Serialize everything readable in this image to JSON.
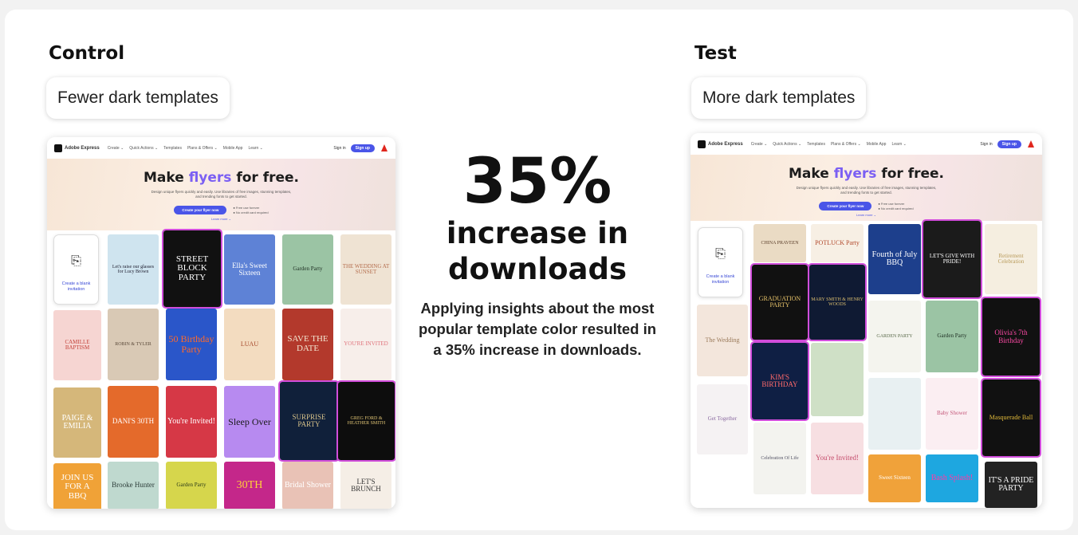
{
  "control": {
    "heading": "Control",
    "label": "Fewer dark templates"
  },
  "test": {
    "heading": "Test",
    "label": "More dark templates"
  },
  "result": {
    "percent": "35%",
    "headline_line1": "increase in",
    "headline_line2": "downloads",
    "description": "Applying insights about the most popular template color resulted in a 35% increase in downloads."
  },
  "mock_page": {
    "brand": "Adobe Express",
    "nav_items": [
      "Create ⌄",
      "Quick Actions ⌄",
      "Templates",
      "Plans & Offers ⌄",
      "Mobile App",
      "Learn ⌄"
    ],
    "sign_in": "Sign in",
    "sign_up": "Sign up",
    "hero_title_prefix": "Make ",
    "hero_title_highlight": "flyers",
    "hero_title_suffix": " for free.",
    "hero_subtitle_line1": "Design unique flyers quickly and easily. Use libraries of free images, stunning templates,",
    "hero_subtitle_line2": "and trending fonts to get started.",
    "cta_label": "Create your flyer now",
    "bullet_1": "● Free use forever",
    "bullet_2": "● No credit card required",
    "learn_more": "Learn more ⌄",
    "blank_label": "Create a blank invitation",
    "blank_icon": "new-document-icon"
  },
  "control_tiles": [
    {
      "text": "Let's raise our glasses for Lucy Brown",
      "bg": "#cfe4ef",
      "fg": "#223"
    },
    {
      "text": "STREET BLOCK PARTY",
      "bg": "#111111",
      "fg": "#ffffff",
      "highlight": true
    },
    {
      "text": "Ella's Sweet Sixteen",
      "bg": "#5e82d6",
      "fg": "#ffffff"
    },
    {
      "text": "Garden Party",
      "bg": "#9bc4a4",
      "fg": "#1d2d22"
    },
    {
      "text": "THE WEDDING AT SUNSET",
      "bg": "#efe3d3",
      "fg": "#b46d4d"
    },
    {
      "text": "CAMILLE BAPTISM",
      "bg": "#f6d5d2",
      "fg": "#c4433b"
    },
    {
      "text": "ROBIN & TYLER",
      "bg": "#d9c9b5",
      "fg": "#5b4a3a"
    },
    {
      "text": "50 Birthday Party",
      "bg": "#2a56c9",
      "fg": "#ff6a2a"
    },
    {
      "text": "LUAU",
      "bg": "#f3dcc0",
      "fg": "#a5482a"
    },
    {
      "text": "SAVE THE DATE",
      "bg": "#b3392c",
      "fg": "#f3e6d2"
    },
    {
      "text": "YOU'RE INVITED",
      "bg": "#f7eeea",
      "fg": "#e0737c"
    },
    {
      "text": "PAIGE & EMILIA",
      "bg": "#d5b77a",
      "fg": "#ffffff"
    },
    {
      "text": "DANI'S 30TH",
      "bg": "#e46a2b",
      "fg": "#ffffff"
    },
    {
      "text": "You're Invited!",
      "bg": "#d63846",
      "fg": "#ffffff"
    },
    {
      "text": "Sleep Over",
      "bg": "#b78af0",
      "fg": "#1b1b1b"
    },
    {
      "text": "SURPRISE PARTY",
      "bg": "#10203a",
      "fg": "#d8c28a",
      "highlight": true
    },
    {
      "text": "GREG FORD & HEATHER SMITH",
      "bg": "#0d0d0d",
      "fg": "#e2c676",
      "highlight": true
    },
    {
      "text": "JOIN US FOR A BBQ",
      "bg": "#f0a237",
      "fg": "#ffffff"
    },
    {
      "text": "Brooke Hunter",
      "bg": "#bfd9cf",
      "fg": "#2d3d3a"
    },
    {
      "text": "Garden Party",
      "bg": "#d6d64c",
      "fg": "#2d3d1a"
    },
    {
      "text": "30TH",
      "bg": "#c4278a",
      "fg": "#ffd23a"
    },
    {
      "text": "Bridal Shower",
      "bg": "#e9c2b6",
      "fg": "#ffffff"
    },
    {
      "text": "LET'S BRUNCH",
      "bg": "#f5eee6",
      "fg": "#333333"
    }
  ],
  "test_tiles": [
    {
      "text": "CHINA PRAVEEN",
      "bg": "#eadbc4",
      "fg": "#5b3e2a"
    },
    {
      "text": "POTLUCK Party",
      "bg": "#f7efe4",
      "fg": "#b24a2d"
    },
    {
      "text": "Fourth of July BBQ",
      "bg": "#1d3f8c",
      "fg": "#ffffff"
    },
    {
      "text": "LET'S GIVE WITH PRIDE!",
      "bg": "#1b1b1b",
      "fg": "#ffffff",
      "highlight": true
    },
    {
      "text": "Retirement Celebration",
      "bg": "#f5eee0",
      "fg": "#b89a5a"
    },
    {
      "text": "GRADUATION PARTY",
      "bg": "#111111",
      "fg": "#e9c46a",
      "highlight": true
    },
    {
      "text": "MARY SMITH & HENRY WOODS",
      "bg": "#0f1a33",
      "fg": "#d8bb6e",
      "highlight": true
    },
    {
      "text": "GARDEN PARTY",
      "bg": "#f4f4ee",
      "fg": "#5a6a4a"
    },
    {
      "text": "Garden Party",
      "bg": "#9bc4a4",
      "fg": "#1d2d22"
    },
    {
      "text": "Olivia's 7th Birthday",
      "bg": "#111111",
      "fg": "#ff4aa6",
      "highlight": true
    },
    {
      "text": "The Wedding",
      "bg": "#f3e6dc",
      "fg": "#9a7a5a"
    },
    {
      "text": "KIM'S BIRTHDAY",
      "bg": "#0f1f44",
      "fg": "#ff6a6a",
      "highlight": true
    },
    {
      "text": "",
      "bg": "#cfe0c6",
      "fg": "#333"
    },
    {
      "text": "",
      "bg": "#e8f0f2",
      "fg": "#333"
    },
    {
      "text": "Baby Shower",
      "bg": "#fbeef2",
      "fg": "#c4577a"
    },
    {
      "text": "Masquerade Ball",
      "bg": "#111111",
      "fg": "#e0b93a",
      "highlight": true
    },
    {
      "text": "Get Together",
      "bg": "#f5f2f3",
      "fg": "#8a6aa0"
    },
    {
      "text": "Celebration Of Life",
      "bg": "#f3f3ef",
      "fg": "#556"
    },
    {
      "text": "You're Invited!",
      "bg": "#f7dfe2",
      "fg": "#c44a6a"
    },
    {
      "text": "Sweet Sixteen",
      "bg": "#f0a23a",
      "fg": "#ffffff"
    },
    {
      "text": "Bash Splash!",
      "bg": "#1ea7e0",
      "fg": "#ff3aa6"
    },
    {
      "text": "IT'S A PRIDE PARTY",
      "bg": "#222222",
      "fg": "#ffffff"
    }
  ]
}
